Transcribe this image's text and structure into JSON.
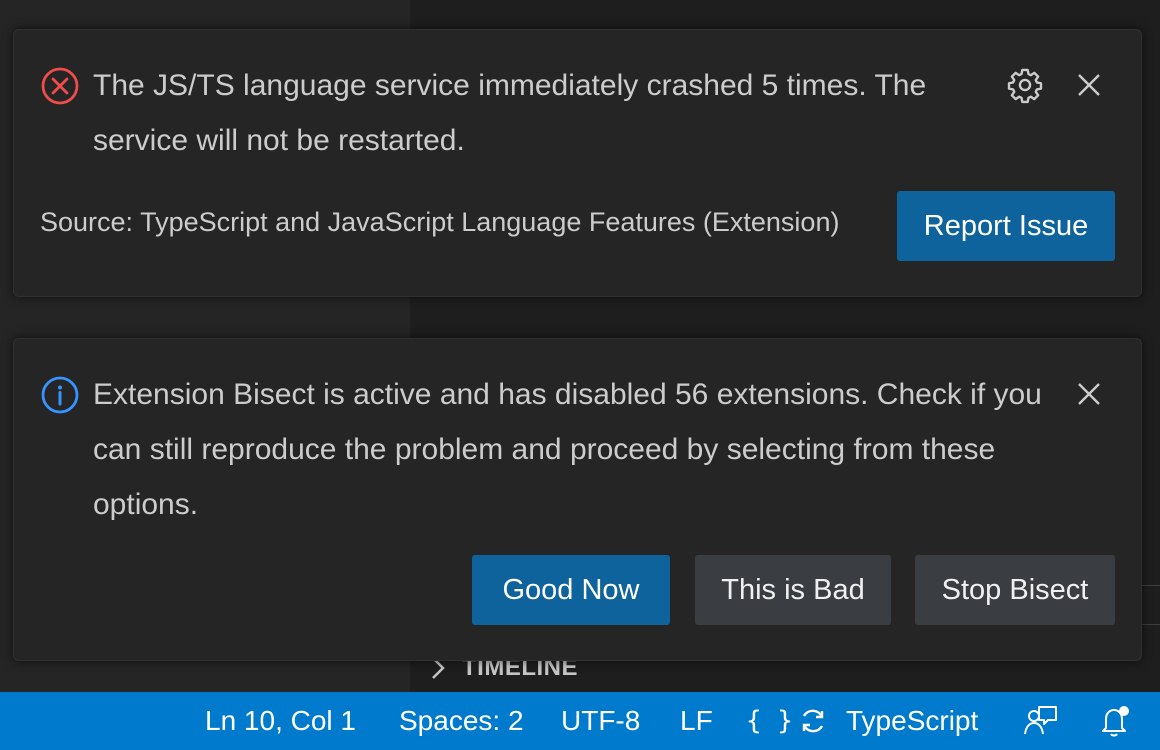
{
  "colors": {
    "error_icon": "#f14c4c",
    "info_icon": "#3794ff",
    "primary_button": "#0e639c",
    "secondary_button": "#3a3d41",
    "statusbar": "#007acc"
  },
  "background": {
    "timeline_label": "TIMELINE"
  },
  "error_toast": {
    "icon": "error-circle-x-icon",
    "message": "The JS/TS language service immediately crashed 5 times. The service will not be restarted.",
    "source": "Source: TypeScript and JavaScript Language Features (Extension)",
    "actions": {
      "report_label": "Report Issue"
    },
    "controls": {
      "settings_icon": "gear-icon",
      "close_icon": "close-icon"
    }
  },
  "info_toast": {
    "icon": "info-icon",
    "message": "Extension Bisect is active and has disabled 56 extensions. Check if you can still reproduce the problem and proceed by selecting from these options.",
    "actions": {
      "good_label": "Good Now",
      "bad_label": "This is Bad",
      "stop_label": "Stop Bisect"
    },
    "controls": {
      "close_icon": "close-icon"
    }
  },
  "statusbar": {
    "position": "Ln 10, Col 1",
    "indentation": "Spaces: 2",
    "encoding": "UTF-8",
    "eol": "LF",
    "braces": "{ }",
    "language": "TypeScript",
    "icons": [
      "braces-icon",
      "sync-icon",
      "feedback-icon",
      "bell-icon"
    ]
  }
}
